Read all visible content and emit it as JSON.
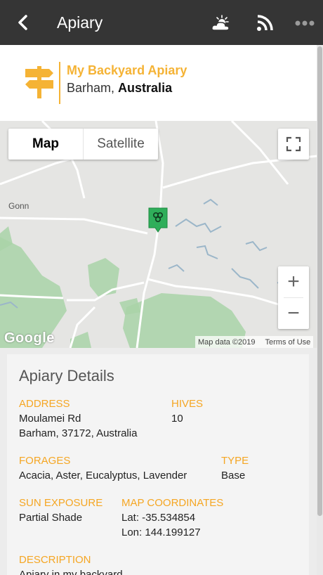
{
  "topbar": {
    "title": "Apiary",
    "icons": [
      "back-chevron-icon",
      "weather-icon",
      "rss-feed-icon",
      "more-dots-icon"
    ]
  },
  "header": {
    "apiary_name": "My Backyard Apiary",
    "city": "Barham,",
    "country": "Australia",
    "accent_color": "#f5b335"
  },
  "map": {
    "map_tab": "Map",
    "satellite_tab": "Satellite",
    "town_label": "Gonn",
    "zoom_in": "+",
    "zoom_out": "−",
    "logo": "Google",
    "data_credit": "Map data ©2019",
    "terms": "Terms of Use",
    "marker_color": "#2fae5a"
  },
  "details": {
    "heading": "Apiary Details",
    "address_label": "ADDRESS",
    "address_line1": "Moulamei Rd",
    "address_line2": "Barham, 37172, Australia",
    "hives_label": "HIVES",
    "hives_value": "10",
    "forages_label": "FORAGES",
    "forages_value": "Acacia, Aster, Eucalyptus, Lavender",
    "type_label": "TYPE",
    "type_value": "Base",
    "sun_label": "SUN EXPOSURE",
    "sun_value": "Partial Shade",
    "coords_label": "MAP COORDINATES",
    "lat": "Lat: -35.534854",
    "lon": "Lon: 144.199127",
    "description_label": "DESCRIPTION",
    "description_value": "Apiary in my backyard"
  }
}
